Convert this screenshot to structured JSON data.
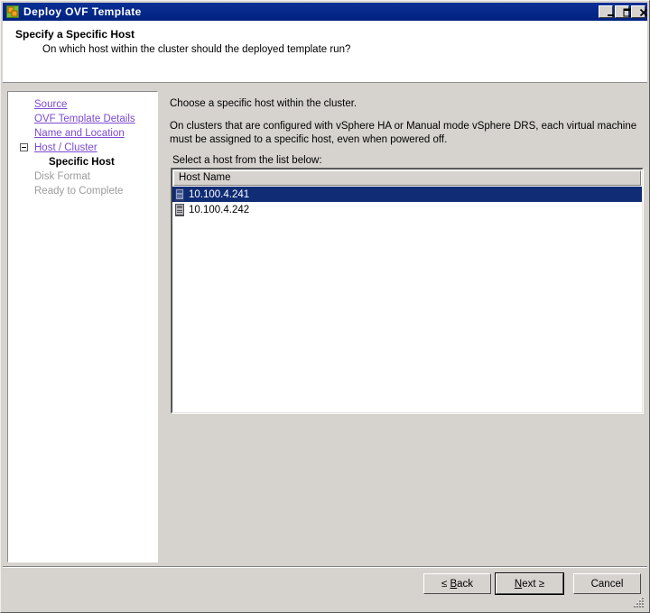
{
  "window": {
    "title": "Deploy OVF Template",
    "icon": "ovf-template-icon",
    "controls": {
      "minimize": "_",
      "maximize": "□",
      "close": "✕"
    }
  },
  "header": {
    "title": "Specify a Specific Host",
    "subtitle": "On which host within the cluster should the deployed template run?"
  },
  "sidebar": {
    "items": [
      {
        "label": "Source",
        "state": "link"
      },
      {
        "label": "OVF Template Details",
        "state": "link"
      },
      {
        "label": "Name and Location",
        "state": "link"
      },
      {
        "label": "Host / Cluster",
        "state": "link",
        "expander": "minus"
      },
      {
        "label": "Specific Host",
        "state": "current"
      },
      {
        "label": "Disk Format",
        "state": "disabled"
      },
      {
        "label": "Ready to Complete",
        "state": "disabled"
      }
    ]
  },
  "main": {
    "paragraph1": "Choose a specific host within the cluster.",
    "paragraph2": "On clusters that are configured with vSphere HA or Manual mode vSphere DRS, each virtual machine must be assigned to a specific host, even when powered off.",
    "list_label": "Select a host from the list below:",
    "list": {
      "column_header": "Host Name",
      "rows": [
        {
          "name": "10.100.4.241",
          "icon": "host-icon",
          "selected": true
        },
        {
          "name": "10.100.4.242",
          "icon": "host-icon",
          "selected": false
        }
      ]
    }
  },
  "footer": {
    "back": {
      "prefix": "≤ ",
      "accel": "B",
      "suffix": "ack"
    },
    "next": {
      "accel": "N",
      "mid": "ext ",
      "suffix": "≥"
    },
    "cancel": "Cancel"
  },
  "colors": {
    "titlebar": "#002c8c",
    "selection": "#0f2c75",
    "dialog_face": "#d6d3ce",
    "link": "#7c4ad0",
    "disabled_text": "#9b9b9b"
  }
}
